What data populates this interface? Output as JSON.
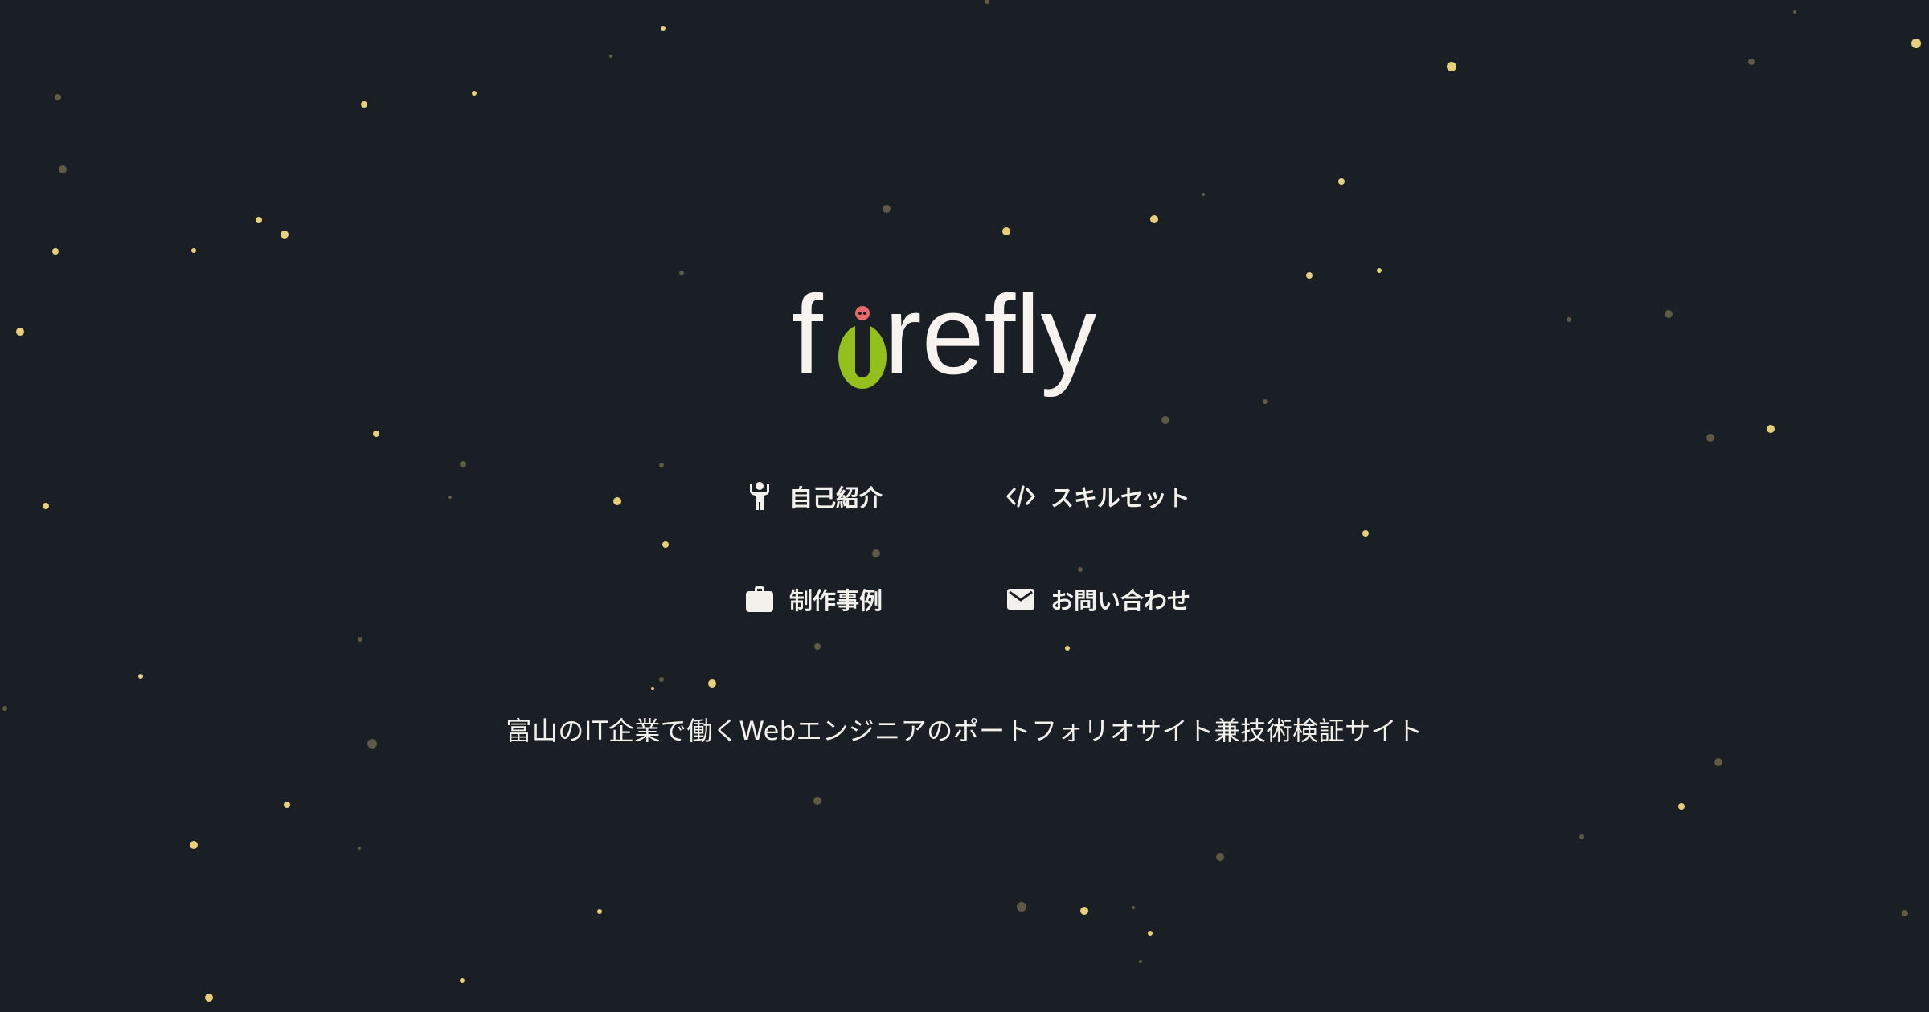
{
  "logo": {
    "text_prefix": "f",
    "text_suffix": "refly",
    "text_color": "#f7f4ef",
    "body_color": "#95bf1d",
    "head_color": "#e86a6a"
  },
  "nav": {
    "items": [
      {
        "label": "自己紹介",
        "icon": "person-icon"
      },
      {
        "label": "スキルセット",
        "icon": "code-icon"
      },
      {
        "label": "制作事例",
        "icon": "briefcase-icon"
      },
      {
        "label": "お問い合わせ",
        "icon": "mail-icon"
      }
    ]
  },
  "tagline": "富山のIT企業で働くWebエンジニアのポートフォリオサイト兼技術検証サイト",
  "colors": {
    "background": "#1a1e25",
    "text": "#f3f1ec",
    "star_bright": "#e8cf7a",
    "star_dim": "#5f5a45"
  }
}
